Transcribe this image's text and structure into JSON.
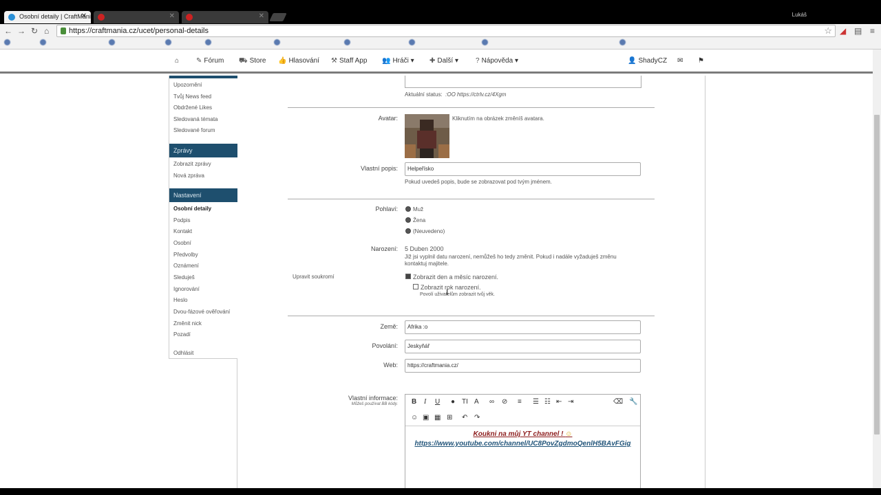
{
  "browser": {
    "tabs": [
      {
        "title": "Osobní detaily | CraftMani",
        "active": true
      },
      {
        "title": "",
        "active": false
      },
      {
        "title": "",
        "active": false
      }
    ],
    "user": "Lukáš",
    "url": "https://craftmania.cz/ucet/personal-details",
    "bookmarks": [
      "",
      "",
      "",
      "",
      "",
      "",
      "",
      "",
      "",
      ""
    ]
  },
  "nav": {
    "home_icon": "home-icon",
    "items": [
      "Fórum",
      "Store",
      "Hlasování",
      "Staff App",
      "Hráči",
      "Další",
      "Nápověda"
    ],
    "user": "ShadyCZ"
  },
  "sidebar": {
    "account_items": [
      "Upozornění",
      "Tvůj News feed",
      "Obdržené Likes",
      "Sledovaná témata",
      "Sledované forum"
    ],
    "messages_header": "Zprávy",
    "message_items": [
      "Zobrazit zprávy",
      "Nová zpráva"
    ],
    "settings_header": "Nastavení",
    "settings_items": [
      "Osobní detaily",
      "Podpis",
      "Kontakt",
      "Osobní",
      "Předvolby",
      "Oznámení",
      "Sleduješ",
      "Ignorování",
      "Heslo",
      "Dvou-fázové ověřování",
      "Změnit nick",
      "Pozadí"
    ],
    "logout": "Odhlásit"
  },
  "form": {
    "status_label": "Aktuální status:",
    "status_value": ":OO https://ctrlv.cz/4Xgm",
    "avatar_label": "Avatar:",
    "avatar_hint": "Kliknutím na obrázek změníš avatara.",
    "custom_title_label": "Vlastní popis:",
    "custom_title_value": "Helpeřísko",
    "custom_title_hint": "Pokud uvedeš popis, bude se zobrazovat pod tvým jménem.",
    "gender_label": "Pohlaví:",
    "gender_options": [
      "Muž",
      "Žena",
      "(Neuvedeno)"
    ],
    "birthday_label": "Narození:",
    "birthday_value": "5 Duben 2000",
    "birthday_hint_1": "Již jsi vyplnil datu narození, nemůžeš ho tedy změnit. Pokud i nadále vyžaduješ změnu",
    "birthday_hint_2": "kontaktuj majitele.",
    "privacy_label": "Upravit soukromí",
    "show_daymonth": "Zobrazit den a měsíc narození.",
    "show_year": "Zobrazit rok narození.",
    "show_year_hint": "Povolí uživatelům zobrazit tvůj věk.",
    "country_label": "Země:",
    "country_value": "Afrika :o",
    "occupation_label": "Povolání:",
    "occupation_value": "Jeskyňář",
    "web_label": "Web:",
    "web_value": "https://craftmania.cz/",
    "about_label": "Vlastní informace:",
    "about_hint": "Můžeš používat BB kódy.",
    "about_line1": "Koukni na můj YT channel !",
    "about_line2": "https://www.youtube.com/channel/UC8PovZgdmoQenlH5BAvFGig"
  },
  "colors": {
    "sidebar_header": "#1e4f6e",
    "about_line1": "#8c1b1b",
    "about_line2": "#22557a"
  }
}
